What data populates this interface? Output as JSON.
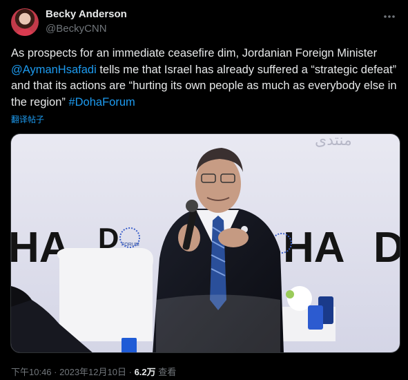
{
  "author": {
    "name": "Becky Anderson",
    "handle": "@BeckyCNN",
    "more_icon": "ellipsis-icon"
  },
  "tweet": {
    "text_part1": "As prospects for an immediate ceasefire dim, Jordanian Foreign Minister ",
    "mention": "@AymanHsafadi",
    "text_part2": " tells me that Israel has already suffered a “strategic defeat” and that its actions are “hurting its own people as much as everybody else in the region” ",
    "hashtag": "#DohaForum",
    "translate_label": "翻译帖子"
  },
  "media": {
    "backdrop_left": "HA",
    "backdrop_right_d": "D",
    "backdrop_right_ha": "HA",
    "backdrop_center_d": "D",
    "logo_small": "FORUM",
    "arabic_watermark": "منتدى"
  },
  "meta": {
    "time": "下午10:46",
    "separator": "·",
    "date": "2023年12月10日",
    "views_count": "6.2万",
    "views_label": "查看"
  },
  "colors": {
    "link": "#1d9bf0",
    "secondary_text": "#71767b",
    "primary_text": "#e7e9ea",
    "background": "#000000"
  }
}
